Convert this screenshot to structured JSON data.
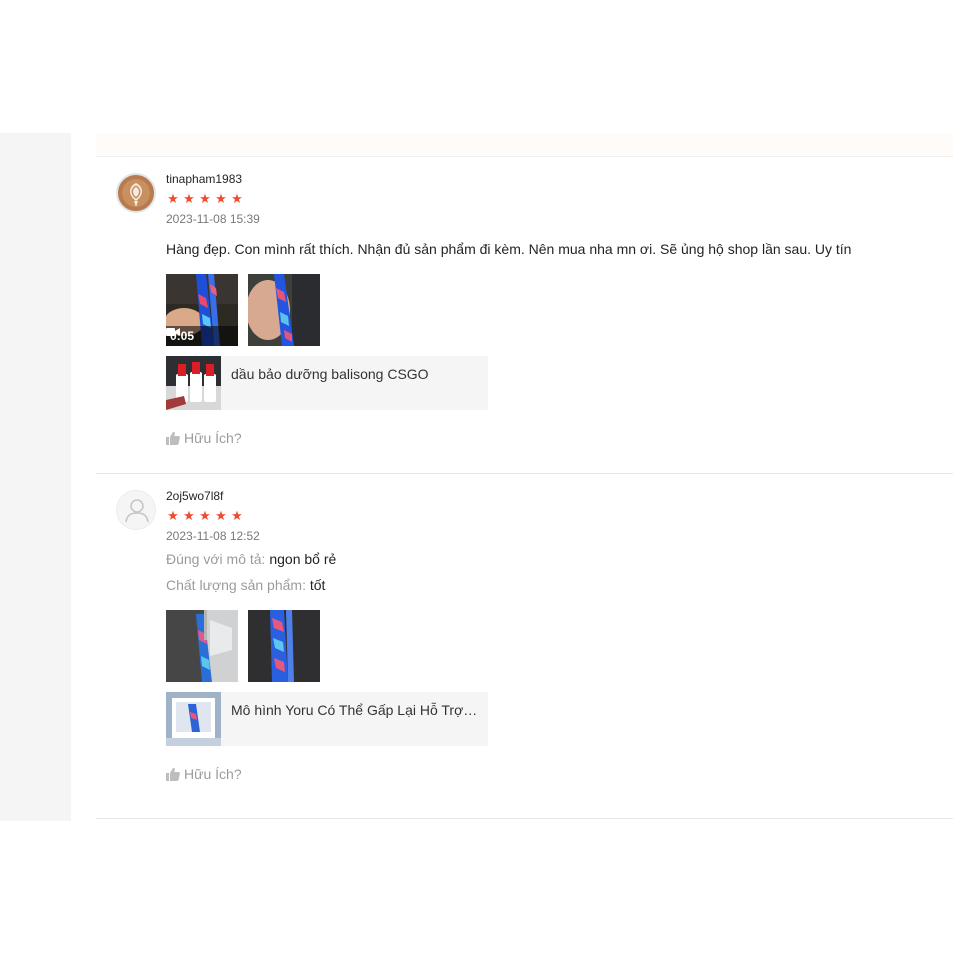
{
  "reviews": [
    {
      "username": "tinapham1983",
      "rating": 5,
      "date": "2023-11-08 15:39",
      "content": "Hàng đẹp. Con mình rất thích. Nhận đủ sản phẩm đi kèm. Nên mua nha mn ơi. Sẽ ủng hộ shop lần sau. Uy tín",
      "video_duration": "0:05",
      "product_name": "dầu bảo dưỡng balisong CSGO",
      "helpful_label": "Hữu Ích?"
    },
    {
      "username": "2oj5wo7l8f",
      "rating": 5,
      "date": "2023-11-08 12:52",
      "attributes": [
        {
          "label": "Đúng với mô tả:",
          "value": "ngon bổ rẻ"
        },
        {
          "label": "Chất lượng sản phẩm:",
          "value": "tốt"
        }
      ],
      "product_name": "Mô hình Yoru Có Thể Gấp Lại Hỗ Trợ Luyện Tập",
      "helpful_label": "Hữu Ích?"
    }
  ],
  "colors": {
    "star": "#ee4d2d",
    "muted": "#bdbdbd"
  },
  "icons": {
    "star": "star-icon",
    "thumb": "thumbs-up-icon",
    "video": "video-camera-icon",
    "avatar_placeholder": "user-icon"
  }
}
